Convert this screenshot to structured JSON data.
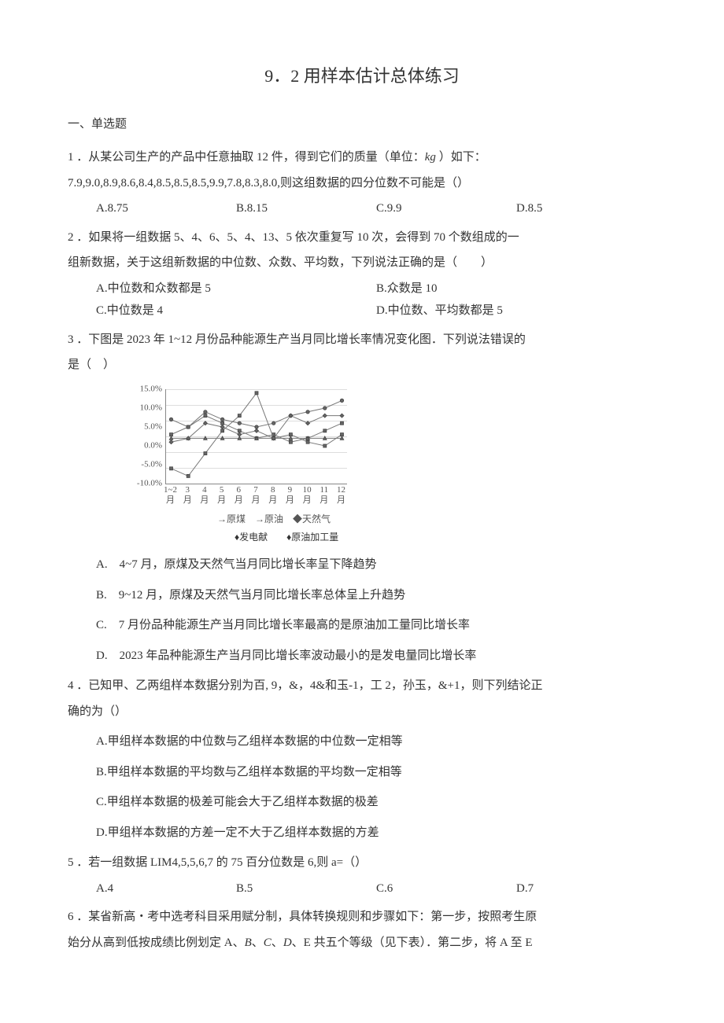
{
  "title": "9．2 用样本估计总体练习",
  "section1": "一、单选题",
  "q1": {
    "stem_a": "1 ．从某公司生产的产品中任意抽取 12 件，得到它们的质量（单位：",
    "unit": "kg",
    "stem_b": " ）如下：",
    "data_line": "7.9,9.0,8.9,8.6,8.4,8.5,8.5,8.5,9.9,7.8,8.3,8.0,则这组数据的四分位数不可能是（）",
    "opts": {
      "a": "A.8.75",
      "b": "B.8.15",
      "c": "C.9.9",
      "d": "D.8.5"
    }
  },
  "q2": {
    "line1": "2 ．如果将一组数据 5、4、6、5、4、13、5 依次重复写 10 次，会得到 70 个数组成的一",
    "line2": "组新数据，关于这组新数据的中位数、众数、平均数，下列说法正确的是（　　）",
    "opts": {
      "a": "A.中位数和众数都是 5",
      "b": "B.众数是 10",
      "c": "C.中位数是 4",
      "d": "D.中位数、平均数都是 5"
    }
  },
  "q3": {
    "line1": "3 ．下图是 2023 年 1~12 月份品种能源生产当月同比增长率情况变化图．下列说法错误的",
    "line2": "是（　）",
    "legend1": "→原煤　→原油　◆天然气",
    "legend2": "♦发电献　　♦原油加工量",
    "opts": {
      "a": "A.　4~7 月，原煤及天然气当月同比增长率呈下降趋势",
      "b": "B.　9~12 月，原煤及天然气当月同比增长率总体呈上升趋势",
      "c": "C.　7 月份品种能源生产当月同比增长率最高的是原油加工量同比增长率",
      "d": "D.　2023 年品种能源生产当月同比增长率波动最小的是发电量同比增长率"
    }
  },
  "q4": {
    "line1": "4 ．已知甲、乙两组样本数据分别为百, 9，&，4&和玉-1，工 2，孙玉，&+1，则下列结论正",
    "line2": "确的为（）",
    "opts": {
      "a": "A.甲组样本数据的中位数与乙组样本数据的中位数一定相等",
      "b": "B.甲组样本数据的平均数与乙组样本数据的平均数一定相等",
      "c": "C.甲组样本数据的极差可能会大于乙组样本数据的极差",
      "d": "D.甲组样本数据的方差一定不大于乙组样本数据的方差"
    }
  },
  "q5": {
    "stem": "5 ．若一组数据 LIM4,5,5,6,7 的 75 百分位数是 6,则 a=（）",
    "opts": {
      "a": "A.4",
      "b": "B.5",
      "c": "C.6",
      "d": "D.7"
    }
  },
  "q6": {
    "line1": "6 ．某省新高・考中选考科目采用赋分制，具体转换规则和步骤如下：第一步，按照考生原",
    "line2_a": "始分从高到低按成绩比例划定 A、",
    "line2_b": "B",
    "line2_c": "、",
    "line2_d": "C",
    "line2_e": "、",
    "line2_f": "D",
    "line2_g": "、E 共五个等级（见下表）．第二步，将 A 至 E"
  },
  "chart_data": {
    "type": "line",
    "title": "",
    "xlabel": "月",
    "ylabel": "",
    "ylim": [
      -10,
      15
    ],
    "y_ticks": [
      "15.0%",
      "10.0%",
      "5.0%",
      "0.0%",
      "-5.0%",
      "-10.0%"
    ],
    "x_categories": [
      "1~2",
      "3",
      "4",
      "5",
      "6",
      "7",
      "8",
      "9",
      "10",
      "11",
      "12"
    ],
    "series": [
      {
        "name": "原煤",
        "values": [
          3,
          5,
          8,
          6,
          4,
          2,
          3,
          1,
          2,
          4,
          6
        ]
      },
      {
        "name": "原油",
        "values": [
          2,
          2,
          2,
          2,
          2,
          2,
          2,
          2,
          2,
          2,
          2
        ]
      },
      {
        "name": "天然气",
        "values": [
          7,
          5,
          9,
          7,
          6,
          5,
          6,
          8,
          9,
          10,
          12
        ]
      },
      {
        "name": "发电量",
        "values": [
          1,
          2,
          6,
          5,
          3,
          4,
          2,
          8,
          6,
          8,
          8
        ]
      },
      {
        "name": "原油加工量",
        "values": [
          -6,
          -8,
          -2,
          4,
          8,
          14,
          2,
          3,
          1,
          0,
          3
        ]
      }
    ]
  }
}
